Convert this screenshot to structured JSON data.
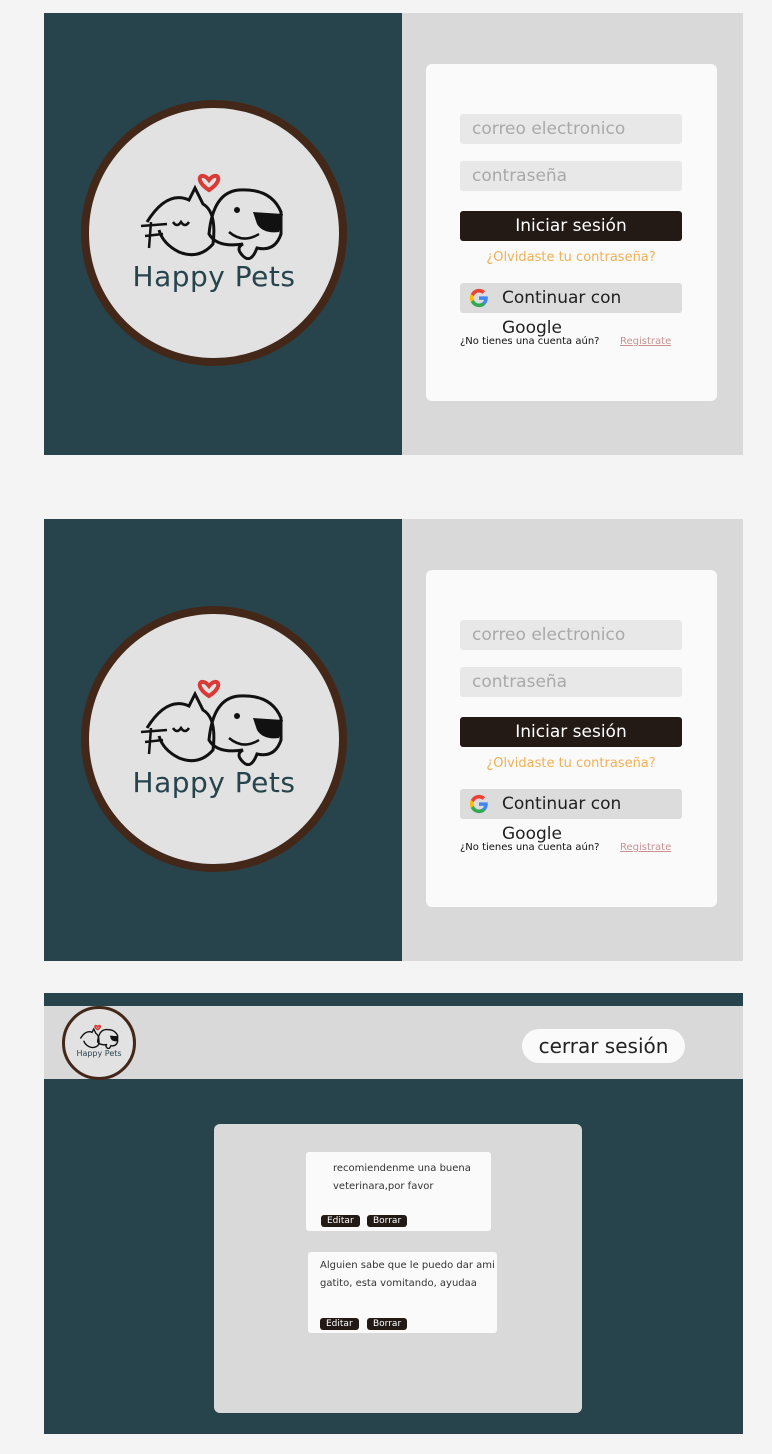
{
  "brand": {
    "name": "Happy Pets"
  },
  "login": {
    "email_placeholder": "correo electronico",
    "password_placeholder": "contraseña",
    "login_label": "Iniciar sesión",
    "forgot_label": "¿Olvidaste tu contraseña?",
    "google_label": "Continuar con Google",
    "signup_prompt": "¿No tienes una cuenta aún?",
    "signup_link": "Registrate"
  },
  "dashboard": {
    "logout_label": "cerrar sesión",
    "posts": [
      {
        "text": "recomiendenme una buena veterinara,por favor",
        "edit_label": "Editar",
        "delete_label": "Borrar"
      },
      {
        "text": "Alguien sabe que le puedo dar ami gatito, esta vomitando, ayudaa",
        "edit_label": "Editar",
        "delete_label": "Borrar"
      }
    ]
  },
  "colors": {
    "primary": "#27444d",
    "accent": "#f0b054",
    "brown": "#432819",
    "dark_button": "#231a16",
    "link": "#c69292"
  }
}
